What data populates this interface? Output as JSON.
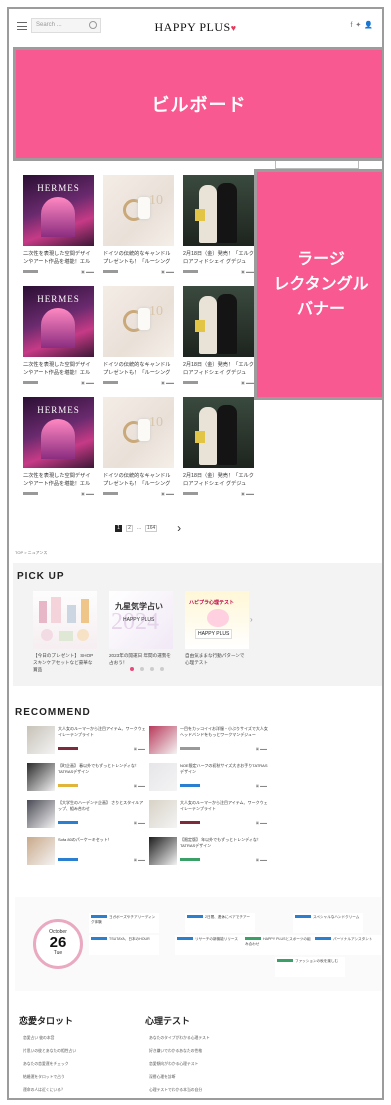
{
  "header": {
    "search_placeholder": "Search ...",
    "logo": "HAPPY PLUS",
    "social_icons": [
      "facebook-icon",
      "twitter-icon",
      "user-icon"
    ]
  },
  "ads": {
    "billboard": "ビルボード",
    "rectangle_lines": [
      "ラージ",
      "レクタングル",
      "バナー"
    ]
  },
  "articles": [
    {
      "thumb": "hermes",
      "brand": "HERMES",
      "title": "二次性を表現した空間デザインやアート作品を堪能！エル"
    },
    {
      "thumb": "candle",
      "title": "ドイツの伝統的なキャンドルプレゼントも！「ルーシング"
    },
    {
      "thumb": "couple",
      "title": "2月18日（金）発売！「エルクロアフィドシェイ グデジュ"
    },
    {
      "thumb": "hermes",
      "brand": "HERMES",
      "title": "二次性を表現した空間デザインやアート作品を堪能！エル"
    },
    {
      "thumb": "candle",
      "title": "ドイツの伝統的なキャンドルプレゼントも！「ルーシング"
    },
    {
      "thumb": "couple",
      "title": "2月18日（金）発売！「エルクロアフィドシェイ グデジュ"
    },
    {
      "thumb": "hermes",
      "brand": "HERMES",
      "title": "二次性を表現した空間デザインやアート作品を堪能！エル"
    },
    {
      "thumb": "candle",
      "title": "ドイツの伝統的なキャンドルプレゼントも！「ルーシング"
    },
    {
      "thumb": "couple",
      "title": "2月18日（金）発売！「エルクロアフィドシェイ グデジュ"
    }
  ],
  "pagination": {
    "pages": [
      "1",
      "2",
      "...",
      "164"
    ],
    "active": "1"
  },
  "breadcrumb": "TOP  >  ニュアンス",
  "pickup": {
    "title": "PICK UP",
    "items": [
      {
        "type": "cosmetics",
        "text": "【今日のプレゼント】 SHOPスキンケアセットなど豪華な賞品"
      },
      {
        "type": "calendar",
        "year": "九星気学占い",
        "brand": "HAPPY PLUS",
        "text": "2023年の開運日 年間の運勢を占おう！"
      },
      {
        "type": "test",
        "heading": "ハピプラ心理テスト",
        "brand": "HAPPY PLUS",
        "text": "自由気ままな行動パターンで心理テスト"
      }
    ],
    "dots": 4,
    "active_dot": 1
  },
  "recommend": {
    "title": "RECOMMEND",
    "items": [
      {
        "text": "大人女のルーマーから注目アイテム、ワークウェイレーテンプライト",
        "tag": "#7d2a3a"
      },
      {
        "text": "一目をカッコイイお洋服・小ぶりサイズで大人女ヘッドバンドをもっとワークマンデジュー",
        "tag": "#999999"
      },
      {
        "text": "【町企画】 春以外でもずっとトレンディな！TATRASデザイン",
        "tag": "#e1b43c"
      },
      {
        "text": "NOE限定ハーフの初秋サイズ大きお手りTATRASデザイン",
        "tag": "#2a7fd0"
      },
      {
        "text": "【大学生のハーデンテ企画】 さりとスタイルアップ、組み合わせ",
        "tag": "#2a7fd0"
      },
      {
        "text": "大人女のルーマーから注目アイテム、ワークウェイレーテンプライト",
        "tag": "#7d2a3a"
      },
      {
        "text": "Sofa 80のパーケーキセット！",
        "tag": "#2a7fd0"
      },
      {
        "text": "【限定版】 年以外でもずっとトレンディな！TATRASデザイン",
        "tag": "#3aa067"
      }
    ]
  },
  "calendar": {
    "month": "October",
    "day": "26",
    "weekday": "Tue",
    "chips": [
      "ヨガポーズやチアリーディング体験",
      "TSUTAYA、日本のHOUR",
      "リサーチの新機能リリース",
      "2日間、連休にペアでチアー",
      "HAPPY PLUSとスポーツの組み合わせ",
      "スペシャルなハンドクリーム",
      "パーソナルアシスタント",
      "ファッションの秋を楽しむ"
    ]
  },
  "tarot": {
    "title": "恋愛タロット",
    "items": [
      "恋愛占い 彼の本音",
      "片思いの彼とあなたの相性占い",
      "あなたの恋愛運をチェック",
      "結婚運をタロットで占う",
      "運命の人は近くにいる？"
    ]
  },
  "test": {
    "title": "心理テスト",
    "items": [
      "あなたのタイプがわかる心理テスト",
      "好き嫌いでわかるあなたの性格",
      "恋愛傾向がわかる心理テスト",
      "深層心理を診断",
      "心理テストでわかる本当の自分"
    ]
  }
}
